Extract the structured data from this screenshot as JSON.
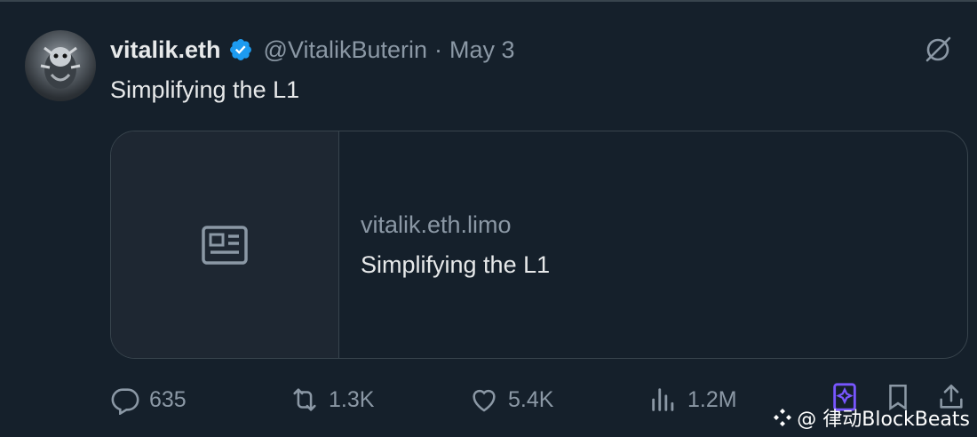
{
  "tweet": {
    "display_name": "vitalik.eth",
    "handle": "@VitalikButerin",
    "separator": "·",
    "date": "May 3",
    "text": "Simplifying the L1"
  },
  "card": {
    "domain": "vitalik.eth.limo",
    "title": "Simplifying the L1"
  },
  "actions": {
    "replies": "635",
    "reposts": "1.3K",
    "likes": "5.4K",
    "views": "1.2M"
  },
  "watermark": {
    "text": "@ 律动BlockBeats"
  },
  "colors": {
    "background": "#15202b",
    "verified": "#1d9bf0",
    "grok": "#7856ff",
    "muted": "#8b98a5"
  },
  "icons": [
    "verified-badge-icon",
    "grok-icon",
    "article-icon",
    "reply-icon",
    "repost-icon",
    "like-icon",
    "views-icon",
    "bookmark-icon",
    "share-icon",
    "watermark-logo-icon"
  ]
}
